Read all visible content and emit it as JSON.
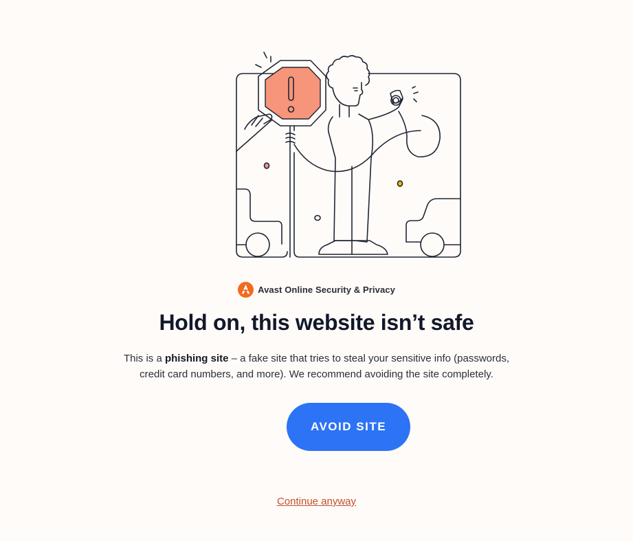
{
  "brand": {
    "name": "Avast Online Security & Privacy",
    "icon": "avast-logo-icon",
    "color": "#f26b1d"
  },
  "warning": {
    "title": "Hold on, this website isn’t safe",
    "description_prefix": "This is a ",
    "description_bold": "phishing site",
    "description_line1_rest": " – a fake site that tries to steal your sensitive info (passwords,",
    "description_line2": "credit card numbers, and more). We recommend avoiding the site completely."
  },
  "actions": {
    "avoid_label": "AVOID SITE",
    "continue_label": "Continue anyway"
  },
  "colors": {
    "background": "#fffbf8",
    "primary_button": "#2c73f5",
    "link": "#c4502c",
    "stop_sign": "#f6957a"
  }
}
